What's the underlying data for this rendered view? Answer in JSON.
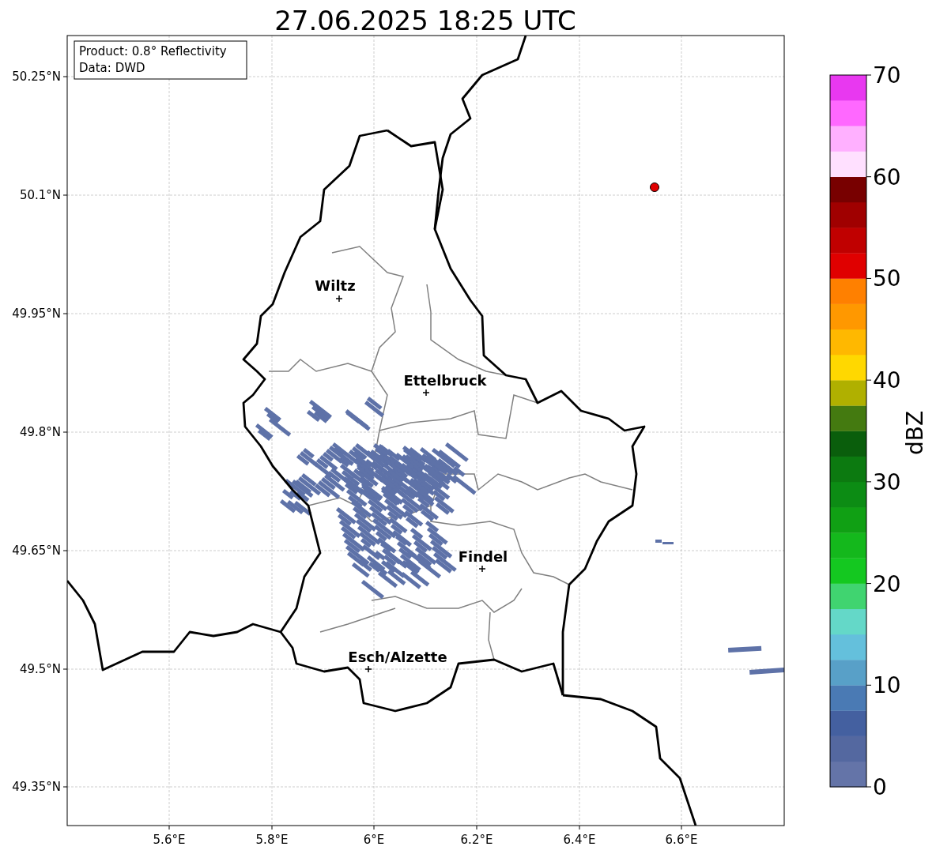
{
  "title": "27.06.2025 18:25 UTC",
  "info_box": {
    "lines": [
      "Product: 0.8° Reflectivity",
      "Data: DWD"
    ]
  },
  "x_ticks": [
    "5.6°E",
    "5.8°E",
    "6°E",
    "6.2°E",
    "6.4°E",
    "6.6°E"
  ],
  "y_ticks": [
    "50.25°N",
    "50.1°N",
    "49.95°N",
    "49.8°N",
    "49.65°N",
    "49.5°N",
    "49.35°N"
  ],
  "cities": [
    {
      "name": "Wiltz"
    },
    {
      "name": "Ettelbruck"
    },
    {
      "name": "Findel"
    },
    {
      "name": "Esch/Alzette"
    }
  ],
  "colorbar": {
    "label": "dBZ",
    "ticks": [
      "70",
      "60",
      "50",
      "40",
      "30",
      "20",
      "10",
      "0"
    ],
    "bands": [
      {
        "color": "#6474a8"
      },
      {
        "color": "#5468a0"
      },
      {
        "color": "#4460a0"
      },
      {
        "color": "#4a7ab4"
      },
      {
        "color": "#58a0c8"
      },
      {
        "color": "#64c0dc"
      },
      {
        "color": "#64d8c8"
      },
      {
        "color": "#40d470"
      },
      {
        "color": "#14c820"
      },
      {
        "color": "#14b81c"
      },
      {
        "color": "#10a014"
      },
      {
        "color": "#0c8c14"
      },
      {
        "color": "#0c7a10"
      },
      {
        "color": "#0a5e0c"
      },
      {
        "color": "#447a10"
      },
      {
        "color": "#b0b000"
      },
      {
        "color": "#ffd800"
      },
      {
        "color": "#ffb800"
      },
      {
        "color": "#ff9800"
      },
      {
        "color": "#ff8000"
      },
      {
        "color": "#e00000"
      },
      {
        "color": "#c00000"
      },
      {
        "color": "#a00000"
      },
      {
        "color": "#780000"
      },
      {
        "color": "#ffe0ff"
      },
      {
        "color": "#ffb0ff"
      },
      {
        "color": "#ff68ff"
      },
      {
        "color": "#e838f0"
      }
    ]
  }
}
